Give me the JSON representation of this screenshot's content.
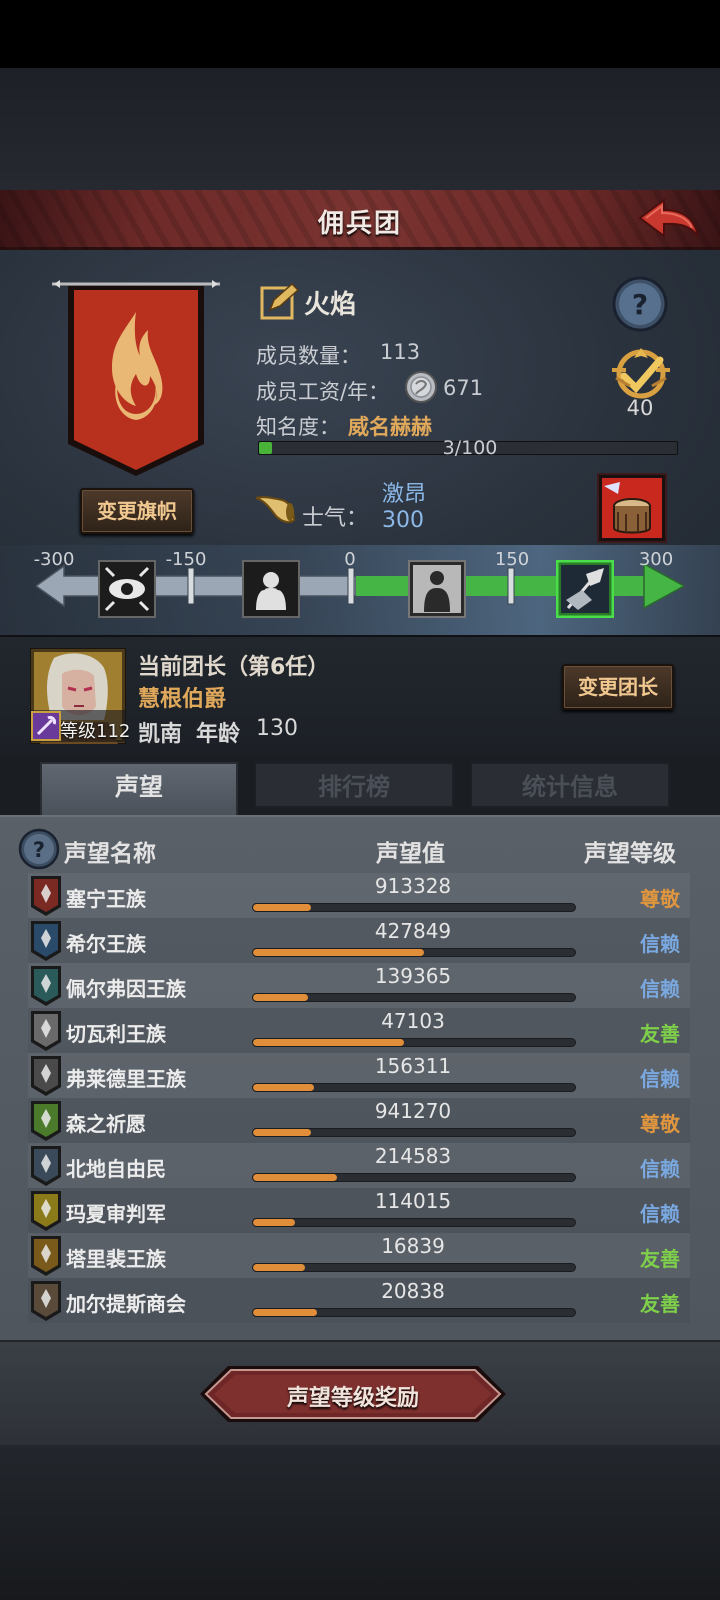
{
  "header": {
    "title": "佣兵团"
  },
  "guild": {
    "name": "火焰",
    "members_label": "成员数量：",
    "members_value": "113",
    "wage_label": "成员工资/年：",
    "wage_value": "671",
    "fame_label": "知名度：",
    "fame_value": "威名赫赫",
    "fame_progress_text": "3/100",
    "fame_progress": 0.03,
    "rank_value": "40",
    "change_flag_label": "变更旗帜"
  },
  "morale": {
    "label": "士气：",
    "state": "激昂",
    "value": "300",
    "ticks": [
      "-300",
      "-150",
      "0",
      "150",
      "300"
    ]
  },
  "leader": {
    "title": "当前团长（第6任）",
    "name": "慧根伯爵",
    "class": "凯南",
    "age_label": "年龄",
    "age": "130",
    "level_text": "等级112",
    "change_leader_label": "变更团长"
  },
  "tabs": [
    {
      "label": "声望",
      "active": true
    },
    {
      "label": "排行榜",
      "active": false
    },
    {
      "label": "统计信息",
      "active": false
    }
  ],
  "table": {
    "headers": {
      "name": "声望名称",
      "value": "声望值",
      "level": "声望等级"
    },
    "rows": [
      {
        "name": "塞宁王族",
        "value": "913328",
        "level": "尊敬",
        "fill": 0.18,
        "level_color": "#e0963e",
        "icon_color": "#7a2a22"
      },
      {
        "name": "希尔王族",
        "value": "427849",
        "level": "信赖",
        "fill": 0.53,
        "level_color": "#7aa8e0",
        "icon_color": "#2a4a6a"
      },
      {
        "name": "佩尔弗因王族",
        "value": "139365",
        "level": "信赖",
        "fill": 0.17,
        "level_color": "#7aa8e0",
        "icon_color": "#2a5a5a"
      },
      {
        "name": "切瓦利王族",
        "value": "47103",
        "level": "友善",
        "fill": 0.47,
        "level_color": "#7ed04a",
        "icon_color": "#6a6a6a"
      },
      {
        "name": "弗莱德里王族",
        "value": "156311",
        "level": "信赖",
        "fill": 0.19,
        "level_color": "#7aa8e0",
        "icon_color": "#4a4a4a"
      },
      {
        "name": "森之祈愿",
        "value": "941270",
        "level": "尊敬",
        "fill": 0.18,
        "level_color": "#e0963e",
        "icon_color": "#4a7a2a"
      },
      {
        "name": "北地自由民",
        "value": "214583",
        "level": "信赖",
        "fill": 0.26,
        "level_color": "#7aa8e0",
        "icon_color": "#3a4a5a"
      },
      {
        "name": "玛夏审判军",
        "value": "114015",
        "level": "信赖",
        "fill": 0.13,
        "level_color": "#7aa8e0",
        "icon_color": "#8a7a1a"
      },
      {
        "name": "塔里裴王族",
        "value": "16839",
        "level": "友善",
        "fill": 0.16,
        "level_color": "#7ed04a",
        "icon_color": "#7a5a1a"
      },
      {
        "name": "加尔提斯商会",
        "value": "20838",
        "level": "友善",
        "fill": 0.2,
        "level_color": "#7ed04a",
        "icon_color": "#5a4a3a"
      }
    ]
  },
  "footer": {
    "reward_label": "声望等级奖励"
  },
  "colors": {
    "fame_bar": "#49b33a",
    "rep_bar": "#e08e3a",
    "accent_orange": "#e0a85a",
    "morale_blue": "#8cb8e8"
  },
  "icons": [
    "back-arrow-icon",
    "help-icon",
    "rank-badge-icon",
    "coin-icon",
    "horn-icon",
    "drum-icon",
    "edit-icon"
  ]
}
